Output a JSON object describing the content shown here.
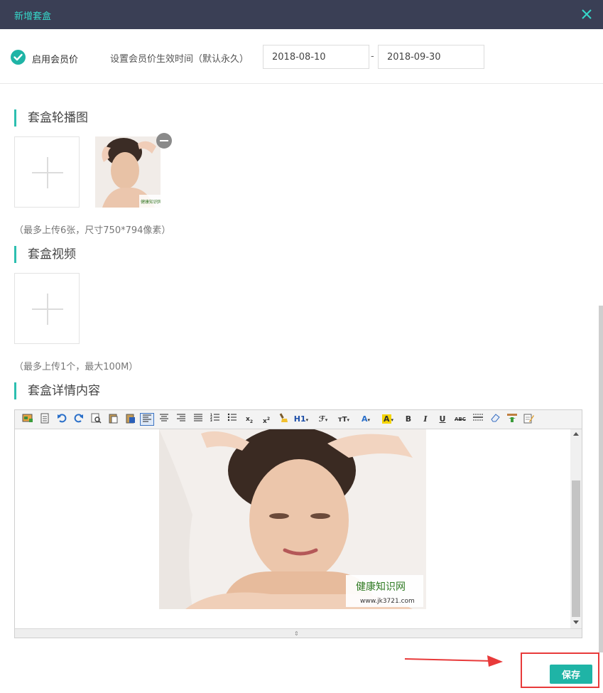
{
  "dialog": {
    "title": "新增套盒"
  },
  "member": {
    "enable_label": "启用会员价",
    "time_label": "设置会员价生效时间（默认永久）",
    "start_date": "2018-08-10",
    "end_date": "2018-09-30",
    "separator": "-"
  },
  "carousel": {
    "title": "套盒轮播图",
    "hint": "（最多上传6张，尺寸750*794像素）"
  },
  "video": {
    "title": "套盒视频",
    "hint": "（最多上传1个，最大100M）"
  },
  "detail": {
    "title": "套盒详情内容",
    "toolbar": {
      "heading": "H1",
      "font_family": "ℱ",
      "font_size": "тT",
      "font_color": "A",
      "bg_color": "A",
      "bold": "B",
      "italic": "I",
      "underline": "U",
      "strikethrough": "ABC"
    },
    "watermark_text": "健康知识网",
    "watermark_url": "www.jk3721.com"
  },
  "colors": {
    "accent": "#1fb4a6",
    "titlebar": "#3a3f55",
    "highlight": "#e83a3a"
  },
  "footer": {
    "save_label": "保存"
  }
}
